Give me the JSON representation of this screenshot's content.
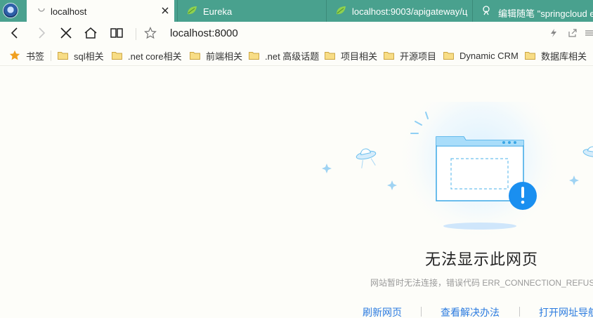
{
  "tabs": [
    {
      "label": "localhost",
      "active": true
    },
    {
      "label": "Eureka",
      "active": false
    },
    {
      "label": "localhost:9003/apigateway/ц",
      "active": false
    },
    {
      "label": "编辑随笔 \"springcloud e",
      "active": false
    }
  ],
  "address_bar": {
    "url": "localhost:8000"
  },
  "bookmarks": {
    "root_label": "书签",
    "items": [
      "sql相关",
      ".net core相关",
      "前端相关",
      ".net 高级话题",
      "项目相关",
      "开源项目",
      "Dynamic CRM",
      "数据库相关"
    ]
  },
  "error_page": {
    "title": "无法显示此网页",
    "description": "网站暂时无法连接，错误代码 ERR_CONNECTION_REFUSED",
    "links": [
      "刷新网页",
      "查看解决办法",
      "打开网址导航"
    ]
  },
  "colors": {
    "tab_strip": "#4aa18f",
    "page_background": "#fdfdf9",
    "link": "#2b7be0",
    "accent_blue": "#1a8ff0",
    "bookmark_star": "#f0a020",
    "folder": "#f2cc5e"
  },
  "icons": [
    "browser-avatar-icon",
    "loading-icon",
    "close-tab-icon",
    "spring-leaf-icon",
    "edit-page-icon",
    "back-icon",
    "forward-icon",
    "stop-icon",
    "home-icon",
    "reading-view-icon",
    "favorite-star-icon",
    "lightning-icon",
    "share-icon",
    "menu-icon",
    "bookmark-star-icon",
    "folder-icon",
    "error-exclamation-icon",
    "ufo-icon",
    "sparkle-icon"
  ]
}
